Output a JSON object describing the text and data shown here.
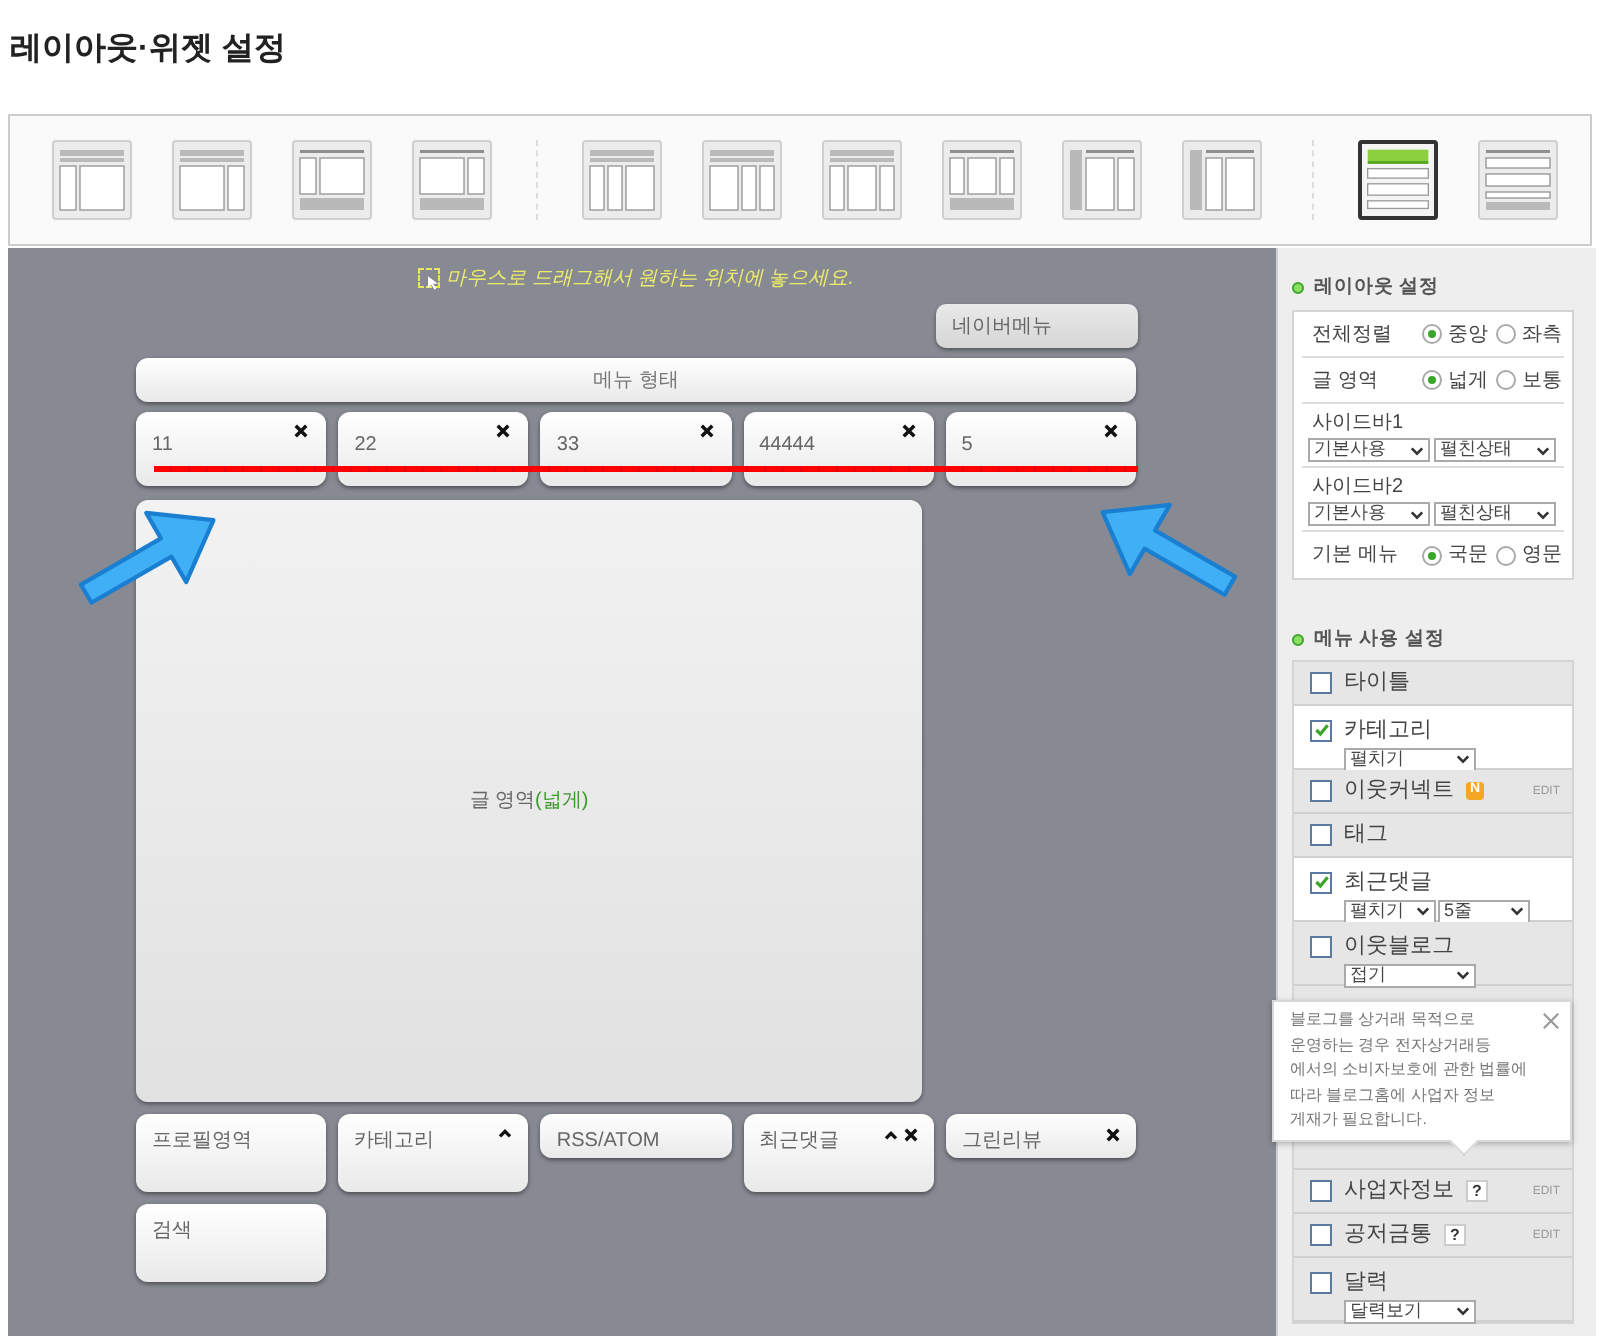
{
  "page_title": "레이아웃·위젯 설정",
  "layouts": [
    {
      "kind": "left",
      "selected": false
    },
    {
      "kind": "right",
      "selected": false
    },
    {
      "kind": "left-footer",
      "selected": false
    },
    {
      "kind": "right-footer",
      "selected": false
    },
    {
      "kind": "three-a",
      "selected": false
    },
    {
      "kind": "three-b",
      "selected": false
    },
    {
      "kind": "three-c",
      "selected": false
    },
    {
      "kind": "three-footer",
      "selected": false
    },
    {
      "kind": "bar-a",
      "selected": false
    },
    {
      "kind": "bar-b",
      "selected": false
    },
    {
      "kind": "stack",
      "selected": true
    },
    {
      "kind": "stack-footer",
      "selected": false
    }
  ],
  "canvas": {
    "hint": "마우스로 드래그해서 원하는 위치에 놓으세요.",
    "top_widget": "네이버메뉴",
    "menu_bar": "메뉴 형태",
    "menu_items": [
      {
        "label": "11"
      },
      {
        "label": "22"
      },
      {
        "label": "33"
      },
      {
        "label": "44444"
      },
      {
        "label": "5"
      }
    ],
    "content_area": {
      "label": "글 영역",
      "suffix": "(넓게)"
    },
    "widgets": [
      {
        "label": "프로필영역",
        "compact": false,
        "collapsible": false,
        "removable": false
      },
      {
        "label": "카테고리",
        "compact": false,
        "collapsible": true,
        "removable": false
      },
      {
        "label": "RSS/ATOM",
        "compact": true,
        "collapsible": false,
        "removable": false
      },
      {
        "label": "최근댓글",
        "compact": false,
        "collapsible": true,
        "removable": true
      },
      {
        "label": "그린리뷰",
        "compact": true,
        "collapsible": false,
        "removable": true
      },
      {
        "label": "검색",
        "compact": false,
        "collapsible": false,
        "removable": false
      }
    ]
  },
  "layout_settings": {
    "title": "레이아웃 설정",
    "rows": [
      {
        "kind": "radio",
        "label": "전체정렬",
        "options": [
          {
            "label": "중앙",
            "selected": true
          },
          {
            "label": "좌측",
            "selected": false
          }
        ]
      },
      {
        "kind": "radio",
        "label": "글 영역",
        "options": [
          {
            "label": "넓게",
            "selected": true
          },
          {
            "label": "보통",
            "selected": false
          }
        ]
      },
      {
        "kind": "selects",
        "label": "사이드바1",
        "selects": [
          "기본사용",
          "펼친상태"
        ]
      },
      {
        "kind": "selects",
        "label": "사이드바2",
        "selects": [
          "기본사용",
          "펼친상태"
        ]
      },
      {
        "kind": "radio",
        "label": "기본 메뉴",
        "options": [
          {
            "label": "국문",
            "selected": true
          },
          {
            "label": "영문",
            "selected": false
          }
        ]
      }
    ]
  },
  "menu_settings": {
    "title": "메뉴 사용 설정",
    "items": [
      {
        "label": "타이틀",
        "checked": false
      },
      {
        "label": "카테고리",
        "checked": true,
        "selects": [
          "펼치기"
        ]
      },
      {
        "label": "이웃커넥트",
        "checked": false,
        "badge": "N",
        "edit": "EDIT"
      },
      {
        "label": "태그",
        "checked": false
      },
      {
        "label": "최근댓글",
        "checked": true,
        "selects": [
          "펼치기",
          "5줄"
        ]
      },
      {
        "label": "이웃블로그",
        "checked": false,
        "selects": [
          "접기"
        ]
      }
    ],
    "tooltip": "블로그를 상거래 목적으로 운영하는 경우 전자상거래등 에서의 소비자보호에 관한 법률에 따라 블로그홈에 사업자 정보 게재가 필요합니다.",
    "items_below": [
      {
        "label": "사업자정보",
        "checked": false,
        "help": "?",
        "edit": "EDIT"
      },
      {
        "label": "공저금통",
        "checked": false,
        "help": "?",
        "edit": "EDIT"
      },
      {
        "label": "달력",
        "checked": false,
        "selects": [
          "달력보기"
        ]
      }
    ]
  }
}
